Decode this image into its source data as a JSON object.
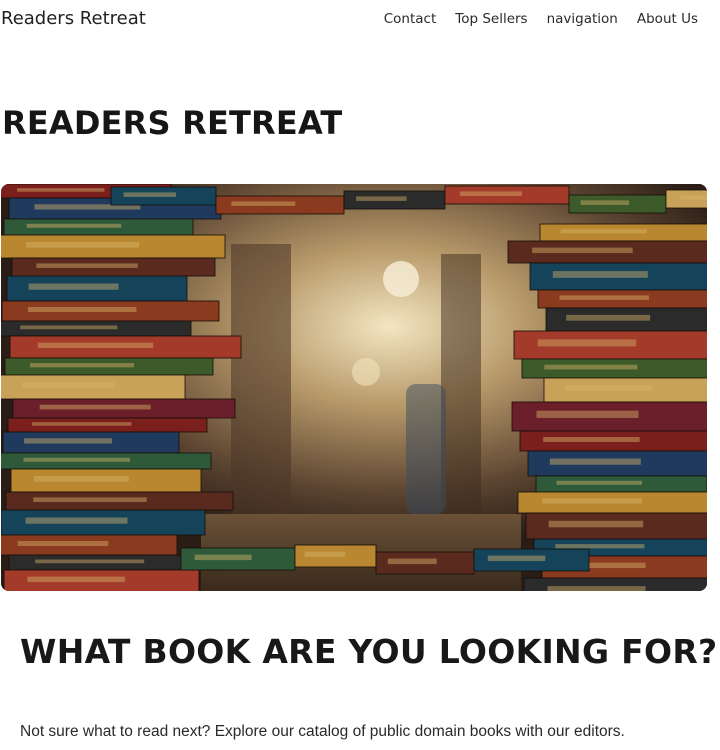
{
  "nav": {
    "brand": "Readers Retreat",
    "links": [
      "Contact",
      "Top Sellers",
      "navigation",
      "About Us"
    ]
  },
  "hero": {
    "title": "READERS RETREAT",
    "image_description": "stacked-books-arch-photo"
  },
  "section": {
    "heading": "WHAT BOOK ARE YOU LOOKING FOR?",
    "text": "Not sure what to read next? Explore our catalog of public domain books with our editors."
  },
  "colors": {
    "spines": [
      "#7a1f1b",
      "#1f3a5c",
      "#2e5a3a",
      "#b8872f",
      "#5b2a1f",
      "#14435a",
      "#8a3a1e",
      "#2b2b2b",
      "#a33a2a",
      "#3d5a2a",
      "#c9a25a",
      "#6b1f2a"
    ]
  }
}
